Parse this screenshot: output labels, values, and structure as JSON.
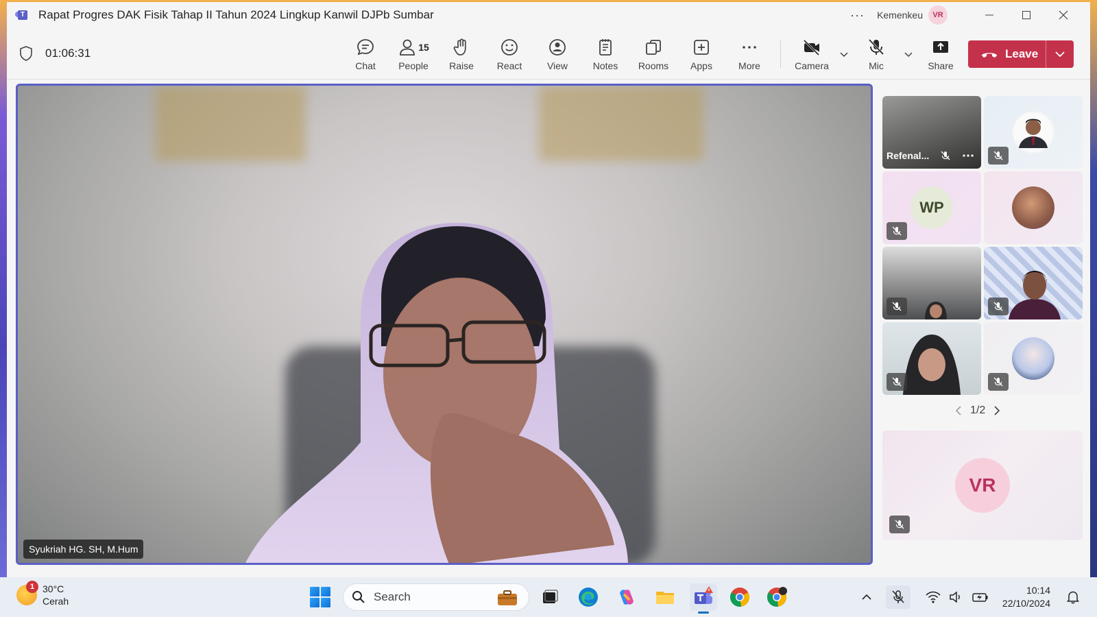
{
  "window": {
    "title": "Rapat Progres DAK Fisik Tahap II Tahun 2024 Lingkup Kanwil DJPb Sumbar",
    "app_icon": "teams-icon",
    "org": "Kemenkeu",
    "avatar_initials": "VR",
    "more_label": "···"
  },
  "toolbar": {
    "timer": "01:06:31",
    "chat": "Chat",
    "people": "People",
    "people_count": "15",
    "raise": "Raise",
    "react": "React",
    "view": "View",
    "notes": "Notes",
    "rooms": "Rooms",
    "apps": "Apps",
    "more": "More",
    "camera": "Camera",
    "mic": "Mic",
    "share": "Share",
    "leave": "Leave"
  },
  "stage": {
    "main_speaker": "Syukriah HG. SH, M.Hum",
    "tiles": [
      {
        "name": "Refenal...",
        "muted": true
      },
      {
        "name": "",
        "muted": true
      },
      {
        "initials": "WP",
        "muted": true
      },
      {
        "name": "",
        "muted": false
      },
      {
        "name": "",
        "muted": true
      },
      {
        "name": "",
        "muted": true
      },
      {
        "name": "",
        "muted": true
      },
      {
        "name": "",
        "muted": true
      }
    ],
    "pager": "1/2",
    "self_initials": "VR"
  },
  "taskbar": {
    "weather_temp": "30°C",
    "weather_desc": "Cerah",
    "weather_badge": "1",
    "search_placeholder": "Search",
    "time": "10:14",
    "date": "22/10/2024"
  },
  "colors": {
    "accent": "#5b5fc7",
    "leave": "#c4314b"
  }
}
